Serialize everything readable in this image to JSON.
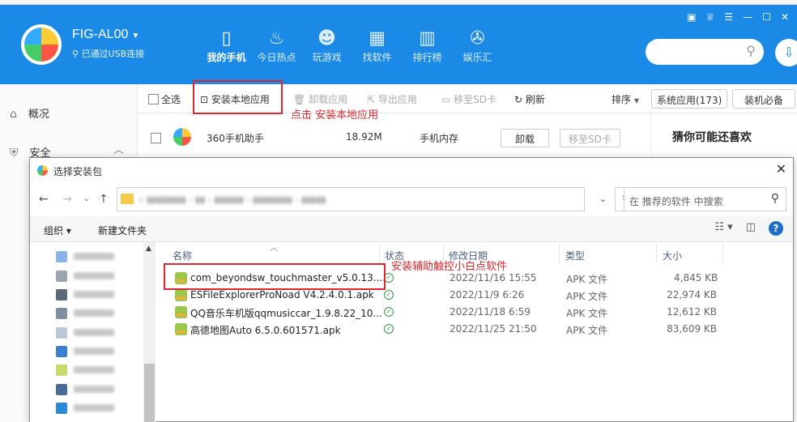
{
  "device": {
    "name": "FIG-AL00",
    "status": "已通过USB连接"
  },
  "nav": [
    {
      "label": "我的手机",
      "icon": "phone-icon",
      "active": true
    },
    {
      "label": "今日热点",
      "icon": "fire-icon"
    },
    {
      "label": "玩游戏",
      "icon": "gamepad-icon"
    },
    {
      "label": "找软件",
      "icon": "apps-icon"
    },
    {
      "label": "排行榜",
      "icon": "chart-icon"
    },
    {
      "label": "娱乐汇",
      "icon": "film-icon"
    }
  ],
  "sidebar": [
    {
      "label": "概况",
      "icon": "home-icon"
    },
    {
      "label": "安全",
      "icon": "shield-icon"
    }
  ],
  "toolbar": {
    "select_all": "全选",
    "install_local": "安装本地应用",
    "uninstall": "卸载应用",
    "export": "导出应用",
    "move_sd": "移至SD卡",
    "refresh": "刷新",
    "sort": "排序",
    "system_apps": "系统应用(173)",
    "essentials": "装机必备"
  },
  "annotations": {
    "install_hint": "点击  安装本地应用",
    "file_hint": "安装辅助触控小白点软件"
  },
  "app_row": {
    "name": "360手机助手",
    "size": "18.92M",
    "location": "手机内存",
    "uninstall": "卸载",
    "move_sd": "移至SD卡"
  },
  "recommend": {
    "title": "猜你可能还喜欢"
  },
  "dialog": {
    "title": "选择安装包",
    "search_placeholder": "在 推荐的软件 中搜索",
    "organize": "组织 ▾",
    "new_folder": "新建文件夹",
    "columns": {
      "name": "名称",
      "status": "状态",
      "date": "修改日期",
      "type": "类型",
      "size": "大小"
    },
    "files": [
      {
        "name": "com_beyondsw_touchmaster_v5.0.13....",
        "date": "2022/11/16 15:55",
        "type": "APK 文件",
        "size": "4,845 KB"
      },
      {
        "name": "ESFileExplorerProNoad V4.2.4.0.1.apk",
        "date": "2022/11/9 6:26",
        "type": "APK 文件",
        "size": "22,974 KB"
      },
      {
        "name": "QQ音乐车机版qqmusiccar_1.9.8.22_10...",
        "date": "2022/11/18 6:59",
        "type": "APK 文件",
        "size": "12,612 KB"
      },
      {
        "name": "高德地图Auto 6.5.0.601571.apk",
        "date": "2022/11/25 21:50",
        "type": "APK 文件",
        "size": "83,609 KB"
      }
    ]
  },
  "colors": {
    "brand": "#1a8ae6",
    "annotation": "#d9282f"
  }
}
